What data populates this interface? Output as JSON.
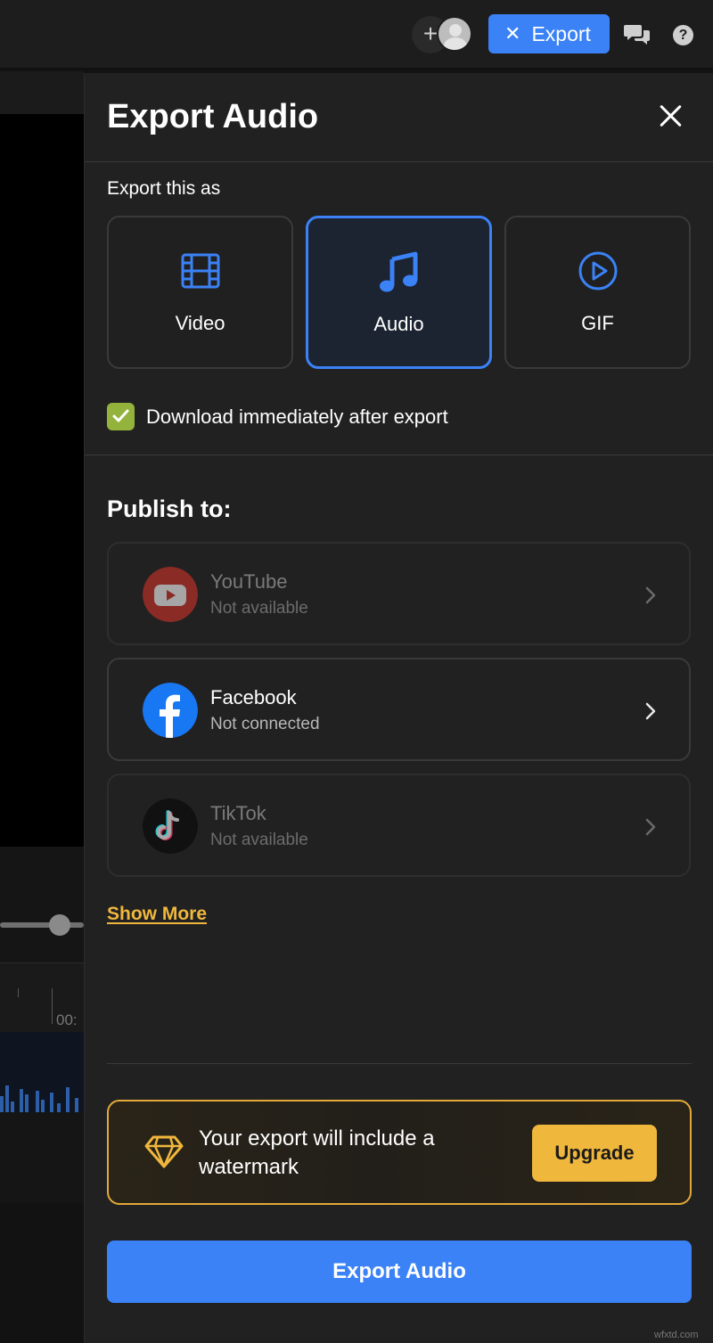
{
  "topbar": {
    "plus_icon": "plus-icon",
    "export_label": "Export",
    "chat_icon": "chat-bubbles-icon",
    "help_label": "?"
  },
  "background": {
    "timeline_time": "00:"
  },
  "panel": {
    "title": "Export Audio",
    "export_as_label": "Export this as",
    "formats": [
      {
        "label": "Video",
        "icon": "film-icon",
        "selected": false
      },
      {
        "label": "Audio",
        "icon": "music-note-icon",
        "selected": true
      },
      {
        "label": "GIF",
        "icon": "play-circle-icon",
        "selected": false
      }
    ],
    "download_checkbox": {
      "label": "Download immediately after export",
      "checked": true
    },
    "publish_title": "Publish to:",
    "publish_targets": [
      {
        "name": "YouTube",
        "status": "Not available",
        "icon": "youtube-icon",
        "available": false
      },
      {
        "name": "Facebook",
        "status": "Not connected",
        "icon": "facebook-icon",
        "available": true
      },
      {
        "name": "TikTok",
        "status": "Not available",
        "icon": "tiktok-icon",
        "available": false
      }
    ],
    "show_more": "Show More",
    "watermark": {
      "text": "Your export will include a watermark",
      "upgrade_label": "Upgrade",
      "icon": "diamond-icon"
    },
    "export_button": "Export Audio"
  },
  "colors": {
    "accent": "#3b82f6",
    "gold": "#f0b73d",
    "checkbox": "#94b33c",
    "panel_bg": "#212121"
  },
  "site_watermark": "wfxtd.com"
}
